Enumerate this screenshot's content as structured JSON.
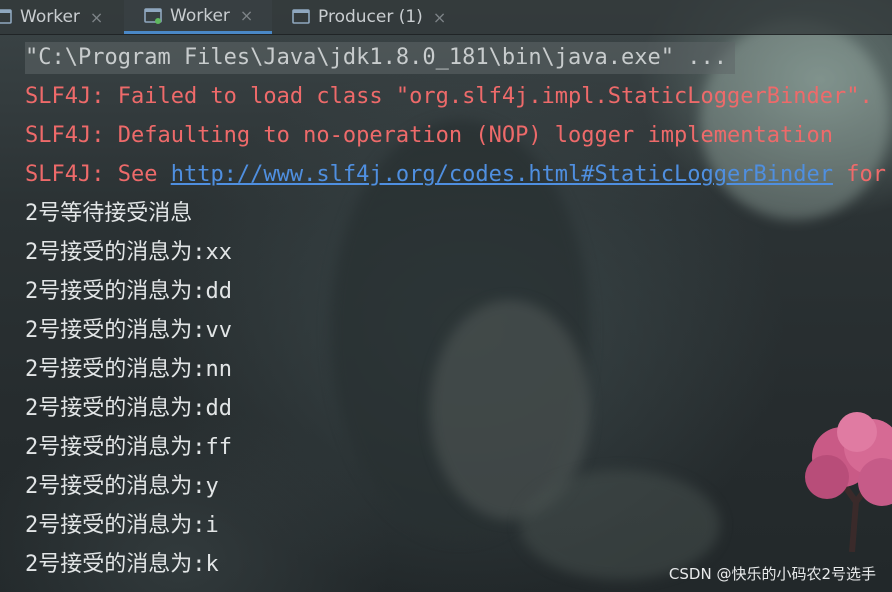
{
  "tabs": [
    {
      "label": "Worker",
      "icon": "console-icon",
      "active": false
    },
    {
      "label": "Worker",
      "icon": "console-icon",
      "active": true
    },
    {
      "label": "Producer (1)",
      "icon": "console-icon",
      "active": false
    }
  ],
  "tab_close_glyph": "×",
  "console": {
    "command": "\"C:\\Program Files\\Java\\jdk1.8.0_181\\bin\\java.exe\" ...",
    "errors": [
      "SLF4J: Failed to load class \"org.slf4j.impl.StaticLoggerBinder\".",
      "SLF4J: Defaulting to no-operation (NOP) logger implementation"
    ],
    "see_prefix": "SLF4J: See ",
    "see_link": "http://www.slf4j.org/codes.html#StaticLoggerBinder",
    "see_suffix": " for further details.",
    "output_lines": [
      "2号等待接受消息",
      "2号接受的消息为:xx",
      "2号接受的消息为:dd",
      "2号接受的消息为:vv",
      "2号接受的消息为:nn",
      "2号接受的消息为:dd",
      "2号接受的消息为:ff",
      "2号接受的消息为:y",
      "2号接受的消息为:i",
      "2号接受的消息为:k"
    ]
  },
  "watermark": "CSDN @快乐的小码农2号选手",
  "colors": {
    "error": "#ee6a6a",
    "link": "#4f8fe0",
    "output": "#e2e5e6",
    "active_tab_underline": "#4a88c7"
  }
}
